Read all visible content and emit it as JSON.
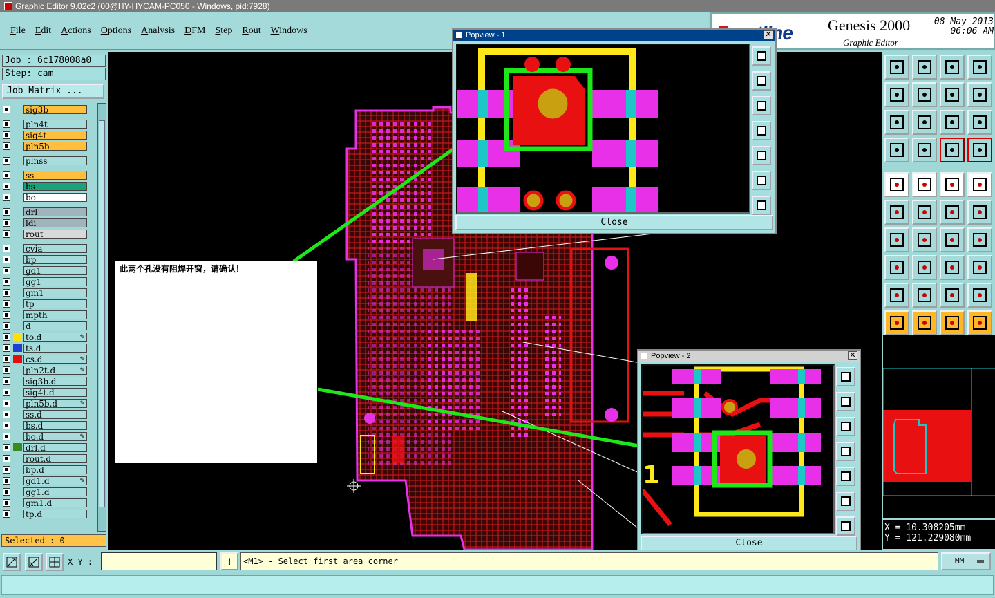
{
  "window": {
    "title": "Graphic Editor 9.02c2 (00@HY-HYCAM-PC050 - Windows, pid:7928)"
  },
  "menu": [
    {
      "ul": "F",
      "rest": "ile"
    },
    {
      "ul": "E",
      "rest": "dit"
    },
    {
      "ul": "A",
      "rest": "ctions"
    },
    {
      "ul": "O",
      "rest": "ptions"
    },
    {
      "ul": "A",
      "rest": "nalysis"
    },
    {
      "ul": "D",
      "rest": "FM"
    },
    {
      "ul": "S",
      "rest": "tep"
    },
    {
      "ul": "R",
      "rest": "out"
    },
    {
      "ul": "W",
      "rest": "indows"
    }
  ],
  "brand": {
    "logo_a": "F",
    "logo_b": "rontline",
    "product": "Genesis 2000",
    "subtitle": "Graphic Editor",
    "date_line1": "08 May 2013",
    "date_line2": "06:06 AM"
  },
  "job": {
    "job_label": "Job  : 6c178008a0",
    "step_label": "Step: cam",
    "matrix_btn": "Job Matrix ..."
  },
  "layers": [
    {
      "name": "sig3b",
      "bg": "#ffbf3c",
      "sw": ""
    },
    {
      "name": "pln4t",
      "bg": "#a6dcdc",
      "sw": ""
    },
    {
      "name": "sig4t",
      "bg": "#ffbf3c",
      "sw": ""
    },
    {
      "name": "pln5b",
      "bg": "#ffbf3c",
      "sw": ""
    },
    {
      "name": "plnss",
      "bg": "#a6dcdc",
      "sw": ""
    },
    {
      "name": "ss",
      "bg": "#ffbf3c",
      "sw": ""
    },
    {
      "name": "bs",
      "bg": "#1aa37a",
      "sw": ""
    },
    {
      "name": "bo",
      "bg": "#ffffff",
      "sw": ""
    },
    {
      "name": "drl",
      "bg": "#9fb4bc",
      "sw": ""
    },
    {
      "name": "ldi",
      "bg": "#9fb4bc",
      "sw": ""
    },
    {
      "name": "rout",
      "bg": "#d9d9d9",
      "sw": ""
    },
    {
      "name": "cvia",
      "bg": "#a6dcdc",
      "sw": ""
    },
    {
      "name": "bp",
      "bg": "#a6dcdc",
      "sw": ""
    },
    {
      "name": "gd1",
      "bg": "#a6dcdc",
      "sw": ""
    },
    {
      "name": "gg1",
      "bg": "#a6dcdc",
      "sw": ""
    },
    {
      "name": "gm1",
      "bg": "#a6dcdc",
      "sw": ""
    },
    {
      "name": "tp",
      "bg": "#a6dcdc",
      "sw": ""
    },
    {
      "name": "mpth",
      "bg": "#a6dcdc",
      "sw": ""
    },
    {
      "name": "d",
      "bg": "#a6dcdc",
      "sw": ""
    },
    {
      "name": "to.d",
      "bg": "#a6dcdc",
      "sw": "#ffe000",
      "ed": true
    },
    {
      "name": "ts.d",
      "bg": "#a6dcdc",
      "sw": "#1f3fd0"
    },
    {
      "name": "cs.d",
      "bg": "#a6dcdc",
      "sw": "#e01010",
      "ed": true
    },
    {
      "name": "pln2t.d",
      "bg": "#a6dcdc",
      "sw": "",
      "ed": true
    },
    {
      "name": "sig3b.d",
      "bg": "#a6dcdc",
      "sw": ""
    },
    {
      "name": "sig4t.d",
      "bg": "#a6dcdc",
      "sw": ""
    },
    {
      "name": "pln5b.d",
      "bg": "#a6dcdc",
      "sw": "",
      "ed": true
    },
    {
      "name": "ss.d",
      "bg": "#a6dcdc",
      "sw": ""
    },
    {
      "name": "bs.d",
      "bg": "#a6dcdc",
      "sw": ""
    },
    {
      "name": "bo.d",
      "bg": "#a6dcdc",
      "sw": "",
      "ed": true
    },
    {
      "name": "drl.d",
      "bg": "#a6dcdc",
      "sw": "#3a8a20"
    },
    {
      "name": "rout.d",
      "bg": "#a6dcdc",
      "sw": ""
    },
    {
      "name": "bp.d",
      "bg": "#a6dcdc",
      "sw": ""
    },
    {
      "name": "gd1.d",
      "bg": "#a6dcdc",
      "sw": "",
      "ed": true
    },
    {
      "name": "gg1.d",
      "bg": "#a6dcdc",
      "sw": ""
    },
    {
      "name": "gm1.d",
      "bg": "#a6dcdc",
      "sw": ""
    },
    {
      "name": "tp.d",
      "bg": "#a6dcdc",
      "sw": ""
    }
  ],
  "selected": "Selected : 0",
  "note": "此两个孔没有阻焊开窗，请确认！",
  "popview1": {
    "title": "Popview - 1",
    "close": "Close"
  },
  "popview2": {
    "title": "Popview - 2",
    "close": "Close"
  },
  "coords": {
    "x": "X  = 10.308205mm",
    "y": "Y  = 121.229080mm"
  },
  "bottom": {
    "xy_label": "X Y :",
    "xy_value": "",
    "warn": "!",
    "prompt": "<M1> - Select first area corner",
    "units": "MM"
  },
  "colors": {
    "magenta": "#e830e8",
    "red": "#e81010",
    "yellow": "#ffe81a",
    "cyan": "#1ec7c7",
    "green": "#1fe81a",
    "gold": "#c8a010"
  }
}
